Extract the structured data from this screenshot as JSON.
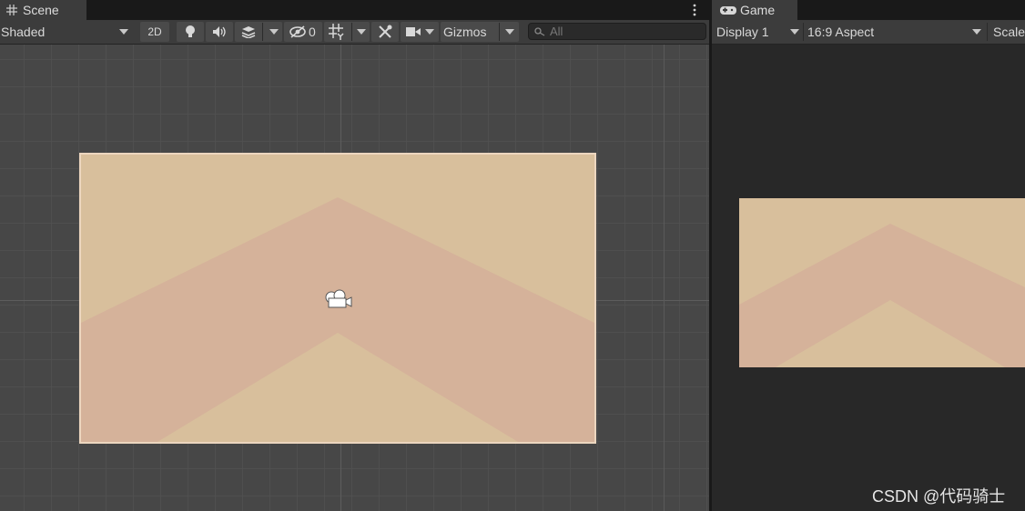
{
  "scene": {
    "tab_label": "Scene",
    "shading_mode": "Shaded",
    "btn_2d": "2D",
    "hidden_count": "0",
    "gizmos_label": "Gizmos",
    "search_placeholder": "All"
  },
  "game": {
    "tab_label": "Game",
    "display": "Display 1",
    "aspect": "16:9 Aspect",
    "scale_label": "Scale"
  },
  "watermark": "CSDN @代码骑士",
  "colors": {
    "sand": "#d8bf9c",
    "stripe": "#d5b29a",
    "frame_border": "#ecd6bf"
  }
}
